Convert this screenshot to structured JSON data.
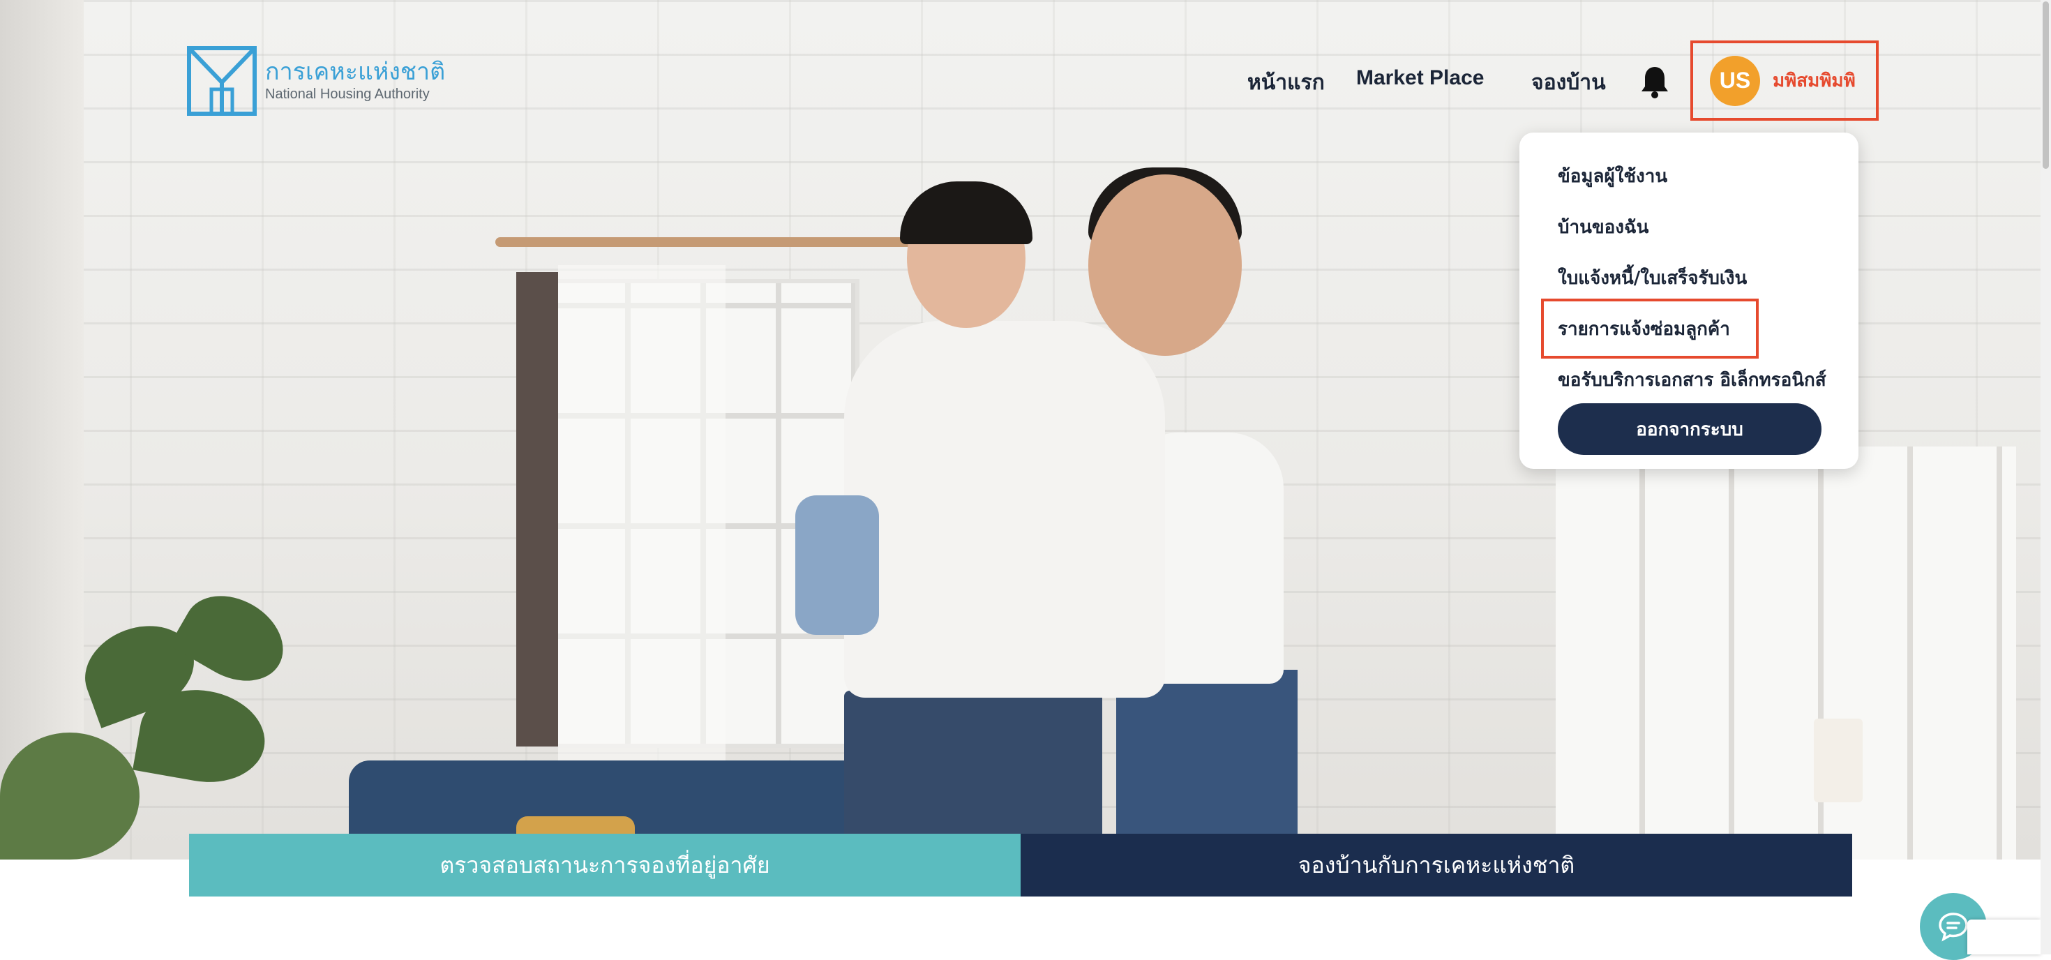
{
  "brand": {
    "name_th": "การเคหะแห่งชาติ",
    "name_en": "National Housing Authority",
    "logo_color": "#3aa0d6"
  },
  "nav": {
    "items": [
      {
        "label": "หน้าแรก"
      },
      {
        "label": "Market Place"
      },
      {
        "label": "จองบ้าน"
      }
    ],
    "notification_icon": "bell-icon"
  },
  "user": {
    "initials": "US",
    "name": "มพิสมพิมพิ",
    "avatar_color": "#f2a02b"
  },
  "user_menu": {
    "items": [
      {
        "label": "ข้อมูลผู้ใช้งาน"
      },
      {
        "label": "บ้านของฉัน"
      },
      {
        "label": "ใบแจ้งหนี้/ใบเสร็จรับเงิน"
      },
      {
        "label": "รายการแจ้งซ่อมลูกค้า",
        "highlighted": true
      },
      {
        "label": "ขอรับบริการเอกสาร อิเล็กทรอนิกส์"
      }
    ],
    "logout_label": "ออกจากระบบ"
  },
  "banner": {
    "check_status_label": "ตรวจสอบสถานะการจองที่อยู่อาศัย",
    "book_label": "จองบ้านกับการเคหะแห่งชาติ"
  },
  "colors": {
    "accent_red": "#e64a2e",
    "teal": "#5bbcbf",
    "navy": "#1b2d4e"
  },
  "chat_icon": "chat-bubble-icon"
}
